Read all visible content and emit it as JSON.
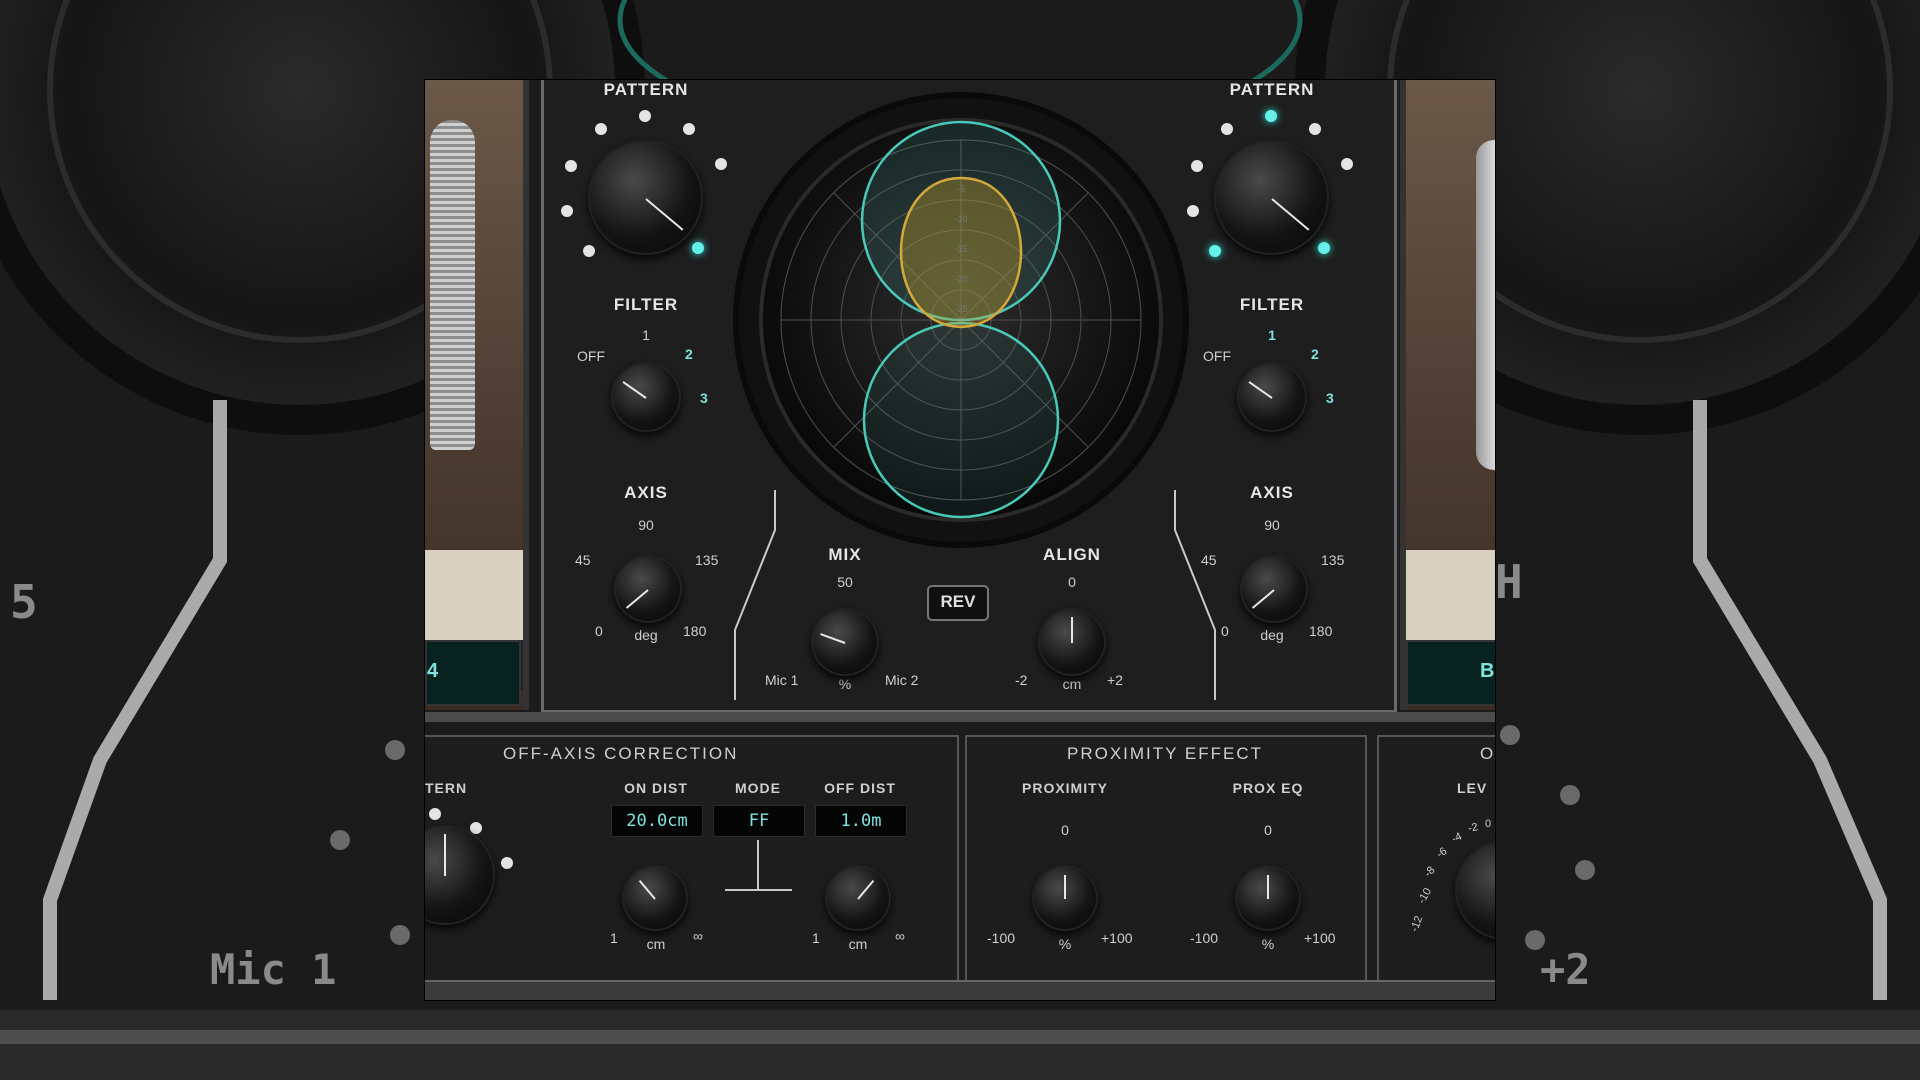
{
  "mic_left": {
    "pattern_label": "PATTERN",
    "filter_label": "FILTER",
    "filter_ticks": [
      "OFF",
      "1",
      "2",
      "3"
    ],
    "axis_label": "AXIS",
    "axis_ticks": [
      "0",
      "45",
      "90",
      "135",
      "180"
    ],
    "axis_unit": "deg",
    "tag": "4"
  },
  "mic_right": {
    "pattern_label": "PATTERN",
    "filter_label": "FILTER",
    "filter_ticks": [
      "OFF",
      "1",
      "2",
      "3"
    ],
    "axis_label": "AXIS",
    "axis_ticks": [
      "0",
      "45",
      "90",
      "135",
      "180"
    ],
    "axis_unit": "deg",
    "tag": "B"
  },
  "mix": {
    "label": "MIX",
    "center": "50",
    "left": "Mic 1",
    "right": "Mic 2",
    "unit": "%"
  },
  "rev_button": "REV",
  "align": {
    "label": "ALIGN",
    "center": "0",
    "left": "-2",
    "right": "+2",
    "unit": "cm"
  },
  "polar_rings": [
    "-5",
    "-10",
    "-15",
    "-20",
    "-25",
    "-30"
  ],
  "off_axis": {
    "title": "OFF-AXIS CORRECTION",
    "pattern_partial": "TERN",
    "on_dist_label": "ON DIST",
    "on_dist_value": "20.0cm",
    "mode_label": "MODE",
    "mode_value": "FF",
    "off_dist_label": "OFF DIST",
    "off_dist_value": "1.0m",
    "range_min": "1",
    "range_max": "∞",
    "unit": "cm"
  },
  "proximity": {
    "title": "PROXIMITY EFFECT",
    "proximity_label": "PROXIMITY",
    "prox_eq_label": "PROX EQ",
    "center": "0",
    "min": "-100",
    "max": "+100",
    "unit": "%"
  },
  "output_partial": {
    "title": "O",
    "level": "LEV",
    "scale": [
      "-12",
      "-10",
      "-8",
      "-6",
      "-4",
      "-2",
      "0"
    ]
  },
  "background": {
    "mic1": "Mic 1",
    "plus2": "+2",
    "s_fragment": "5",
    "h_fragment": "H"
  }
}
